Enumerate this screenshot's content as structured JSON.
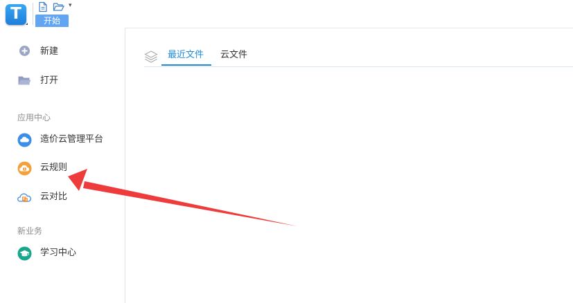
{
  "toolbar": {
    "start_tab": "开始",
    "more_symbol": "▾"
  },
  "sidebar": {
    "new_label": "新建",
    "open_label": "打开",
    "app_center_heading": "应用中心",
    "apps": [
      {
        "label": "造价云管理平台",
        "icon": "cloud-icon"
      },
      {
        "label": "云规则",
        "icon": "info-cloud-icon"
      },
      {
        "label": "云对比",
        "icon": "cloud-compare-icon"
      }
    ],
    "new_business_heading": "新业务",
    "business": [
      {
        "label": "学习中心",
        "icon": "graduation-cap-icon"
      }
    ]
  },
  "main": {
    "tabs": [
      {
        "label": "最近文件",
        "active": true
      },
      {
        "label": "云文件",
        "active": false
      }
    ]
  },
  "colors": {
    "accent": "#1f8ad8",
    "start_tab": "#62a6f3",
    "arrow": "#ee3b3b",
    "cloud_app": "#3c8ee8",
    "rules_app": "#f3a13c",
    "learning_app": "#1aa58d"
  }
}
